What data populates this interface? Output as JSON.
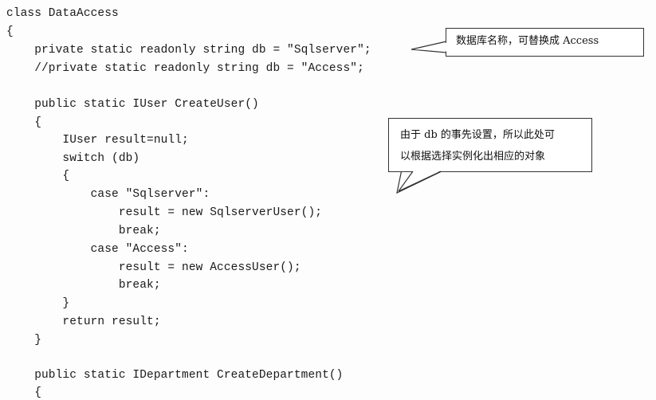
{
  "code_lines": [
    "class DataAccess",
    "{",
    "    private static readonly string db = \"Sqlserver\";",
    "    //private static readonly string db = \"Access\";",
    "",
    "    public static IUser CreateUser()",
    "    {",
    "        IUser result=null;",
    "        switch (db)",
    "        {",
    "            case \"Sqlserver\":",
    "                result = new SqlserverUser();",
    "                break;",
    "            case \"Access\":",
    "                result = new AccessUser();",
    "                break;",
    "        }",
    "        return result;",
    "    }",
    "",
    "    public static IDepartment CreateDepartment()",
    "    {"
  ],
  "callouts": {
    "db_note": "数据库名称，可替换成 Access",
    "switch_note_line1": "由于 db 的事先设置，所以此处可",
    "switch_note_line2": "以根据选择实例化出相应的对象"
  }
}
